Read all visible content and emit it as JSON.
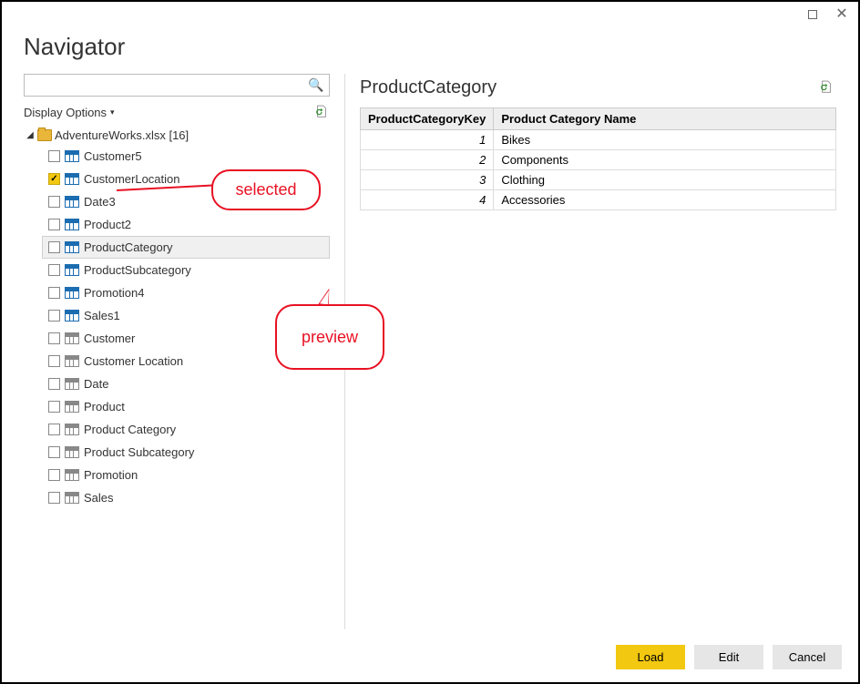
{
  "window": {
    "title": "Navigator"
  },
  "left": {
    "search_placeholder": "",
    "display_options": "Display Options",
    "root": {
      "label": "AdventureWorks.xlsx [16]"
    },
    "items": [
      {
        "label": "Customer5",
        "checked": false,
        "highlight": false,
        "blue": true
      },
      {
        "label": "CustomerLocation",
        "checked": true,
        "highlight": false,
        "blue": true
      },
      {
        "label": "Date3",
        "checked": false,
        "highlight": false,
        "blue": true
      },
      {
        "label": "Product2",
        "checked": false,
        "highlight": false,
        "blue": true
      },
      {
        "label": "ProductCategory",
        "checked": false,
        "highlight": true,
        "blue": true
      },
      {
        "label": "ProductSubcategory",
        "checked": false,
        "highlight": false,
        "blue": true
      },
      {
        "label": "Promotion4",
        "checked": false,
        "highlight": false,
        "blue": true
      },
      {
        "label": "Sales1",
        "checked": false,
        "highlight": false,
        "blue": true
      },
      {
        "label": "Customer",
        "checked": false,
        "highlight": false,
        "blue": false
      },
      {
        "label": "Customer Location",
        "checked": false,
        "highlight": false,
        "blue": false
      },
      {
        "label": "Date",
        "checked": false,
        "highlight": false,
        "blue": false
      },
      {
        "label": "Product",
        "checked": false,
        "highlight": false,
        "blue": false
      },
      {
        "label": "Product Category",
        "checked": false,
        "highlight": false,
        "blue": false
      },
      {
        "label": "Product Subcategory",
        "checked": false,
        "highlight": false,
        "blue": false
      },
      {
        "label": "Promotion",
        "checked": false,
        "highlight": false,
        "blue": false
      },
      {
        "label": "Sales",
        "checked": false,
        "highlight": false,
        "blue": false
      }
    ]
  },
  "right": {
    "title": "ProductCategory",
    "columns": [
      "ProductCategoryKey",
      "Product Category Name"
    ],
    "rows": [
      {
        "key": "1",
        "name": "Bikes"
      },
      {
        "key": "2",
        "name": "Components"
      },
      {
        "key": "3",
        "name": "Clothing"
      },
      {
        "key": "4",
        "name": "Accessories"
      }
    ]
  },
  "footer": {
    "load": "Load",
    "edit": "Edit",
    "cancel": "Cancel"
  },
  "annotations": {
    "selected": "selected",
    "preview": "preview"
  }
}
